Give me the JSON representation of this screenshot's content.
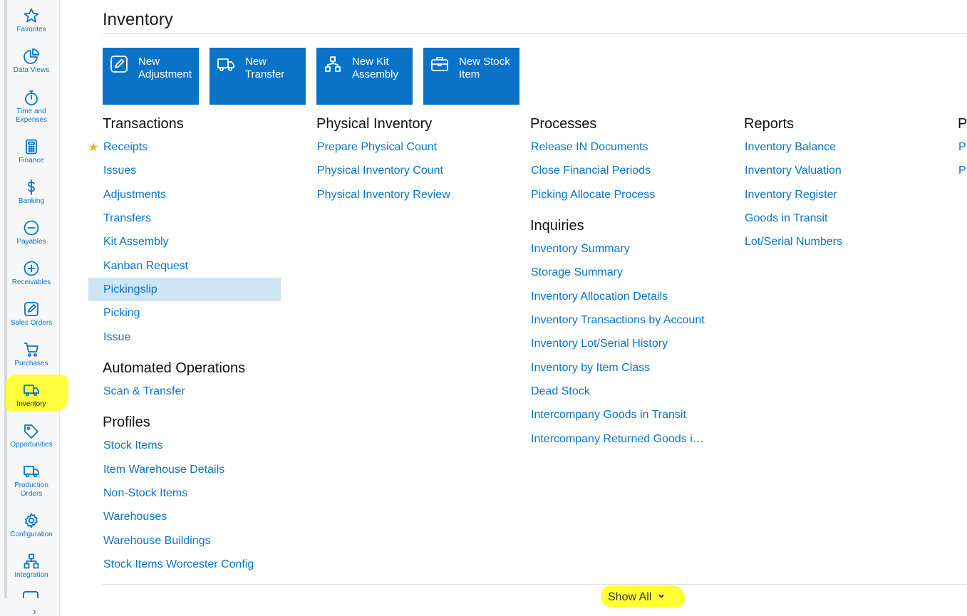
{
  "sidebar": {
    "items": [
      {
        "label": "Favorites",
        "icon": "star-icon"
      },
      {
        "label": "Data Views",
        "icon": "pie-chart-icon"
      },
      {
        "label": "Time and\nExpenses",
        "icon": "stopwatch-icon"
      },
      {
        "label": "Finance",
        "icon": "calculator-icon"
      },
      {
        "label": "Banking",
        "icon": "dollar-icon"
      },
      {
        "label": "Payables",
        "icon": "minus-circle-icon"
      },
      {
        "label": "Receivables",
        "icon": "plus-circle-icon"
      },
      {
        "label": "Sales Orders",
        "icon": "pencil-icon"
      },
      {
        "label": "Purchases",
        "icon": "cart-icon"
      },
      {
        "label": "Inventory",
        "icon": "truck-icon",
        "active": true
      },
      {
        "label": "Opportunities",
        "icon": "tag-icon"
      },
      {
        "label": "Production\nOrders",
        "icon": "truck-icon"
      },
      {
        "label": "Configuration",
        "icon": "gear-icon"
      },
      {
        "label": "Integration",
        "icon": "network-icon"
      }
    ],
    "expand_glyph": "›"
  },
  "page": {
    "title": "Inventory"
  },
  "tiles": [
    {
      "label": "New\nAdjustment",
      "icon": "edit-icon"
    },
    {
      "label": "New\nTransfer",
      "icon": "truck-icon"
    },
    {
      "label": "New Kit\nAssembly",
      "icon": "hierarchy-icon"
    },
    {
      "label": "New Stock\nItem",
      "icon": "briefcase-icon"
    }
  ],
  "sections": {
    "transactions": {
      "title": "Transactions",
      "links": [
        "Receipts",
        "Issues",
        "Adjustments",
        "Transfers",
        "Kit Assembly",
        "Kanban Request",
        "Pickingslip",
        "Picking",
        "Issue"
      ]
    },
    "automated": {
      "title": "Automated Operations",
      "links": [
        "Scan & Transfer"
      ]
    },
    "profiles": {
      "title": "Profiles",
      "links": [
        "Stock Items",
        "Item Warehouse Details",
        "Non-Stock Items",
        "Warehouses",
        "Warehouse Buildings",
        "Stock Items Worcester Config"
      ]
    },
    "physical": {
      "title": "Physical Inventory",
      "links": [
        "Prepare Physical Count",
        "Physical Inventory Count",
        "Physical Inventory Review"
      ]
    },
    "processes": {
      "title": "Processes",
      "links": [
        "Release IN Documents",
        "Close Financial Periods",
        "Picking Allocate Process"
      ]
    },
    "inquiries": {
      "title": "Inquiries",
      "links": [
        "Inventory Summary",
        "Storage Summary",
        "Inventory Allocation Details",
        "Inventory Transactions by Account",
        "Inventory Lot/Serial History",
        "Inventory by Item Class",
        "Dead Stock",
        "Intercompany Goods in Transit",
        "Intercompany Returned Goods i…"
      ]
    },
    "reports": {
      "title": "Reports",
      "links": [
        "Inventory Balance",
        "Inventory Valuation",
        "Inventory Register",
        "Goods in Transit",
        "Lot/Serial Numbers"
      ]
    },
    "cutoff": {
      "title": "P",
      "links": [
        "P",
        "P"
      ]
    }
  },
  "footer": {
    "show_all": "Show All"
  },
  "colors": {
    "accent": "#0a73c8",
    "selected_row": "#cde5f5",
    "highlight": "#ffff33",
    "favorite_star": "#f0ad1b"
  }
}
